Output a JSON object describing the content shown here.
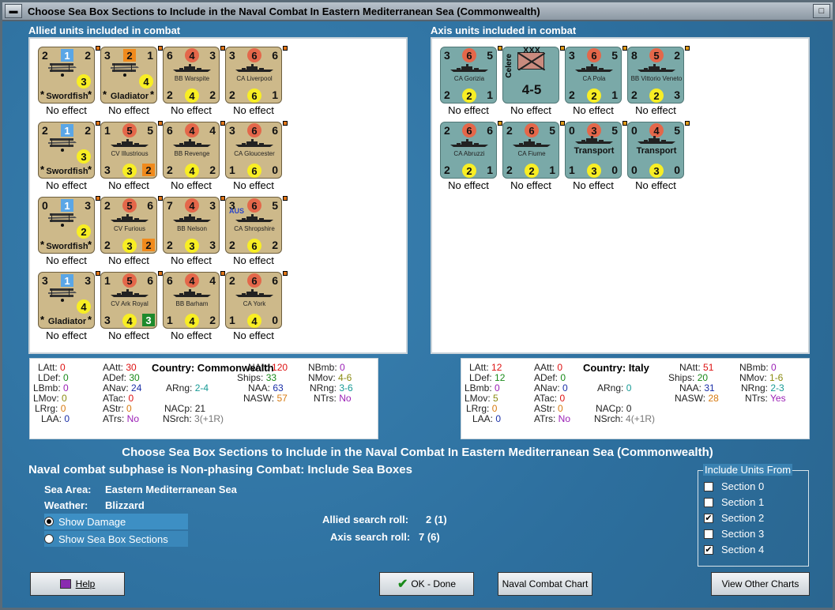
{
  "window": {
    "title": "Choose Sea Box Sections to Include in the Naval Combat In Eastern Mediterranean Sea (Commonwealth)"
  },
  "allied": {
    "header": "Allied units included in combat",
    "units": [
      {
        "l": "2",
        "c": "1",
        "r": "2",
        "bl": "",
        "bc": "3",
        "br": "",
        "name": "Swordfish",
        "kind": "air",
        "effect": "No effect"
      },
      {
        "l": "3",
        "c": "2",
        "r": "1",
        "bl": "",
        "bc": "4",
        "br": "",
        "name": "Gladiator",
        "kind": "air",
        "effect": "No effect"
      },
      {
        "l": "6",
        "c": "4",
        "r": "3",
        "bl": "2",
        "bc": "4",
        "br": "2",
        "name": "BB Warspite",
        "kind": "ship",
        "effect": "No effect"
      },
      {
        "l": "3",
        "c": "6",
        "r": "6",
        "bl": "2",
        "bc": "6",
        "br": "1",
        "name": "CA Liverpool",
        "kind": "ship",
        "effect": "No effect"
      },
      {
        "l": "2",
        "c": "1",
        "r": "2",
        "bl": "",
        "bc": "3",
        "br": "",
        "name": "Swordfish",
        "kind": "air",
        "effect": "No effect"
      },
      {
        "l": "1",
        "c": "5",
        "r": "5",
        "bl": "3",
        "bc": "3",
        "br": "2",
        "name": "CV Illustrious",
        "kind": "ship",
        "effect": "No effect"
      },
      {
        "l": "6",
        "c": "4",
        "r": "4",
        "bl": "2",
        "bc": "4",
        "br": "2",
        "name": "BB Revenge",
        "kind": "ship",
        "effect": "No effect"
      },
      {
        "l": "3",
        "c": "6",
        "r": "6",
        "bl": "1",
        "bc": "6",
        "br": "0",
        "name": "CA Gloucester",
        "kind": "ship",
        "effect": "No effect"
      },
      {
        "l": "0",
        "c": "1",
        "r": "3",
        "bl": "",
        "bc": "2",
        "br": "",
        "name": "Swordfish",
        "kind": "air",
        "effect": "No effect"
      },
      {
        "l": "2",
        "c": "5",
        "r": "6",
        "bl": "2",
        "bc": "3",
        "br": "2",
        "name": "CV Furious",
        "kind": "ship",
        "effect": "No effect"
      },
      {
        "l": "7",
        "c": "4",
        "r": "3",
        "bl": "2",
        "bc": "3",
        "br": "3",
        "name": "BB Nelson",
        "kind": "ship",
        "effect": "No effect"
      },
      {
        "l": "3",
        "c": "6",
        "r": "5",
        "bl": "2",
        "bc": "6",
        "br": "2",
        "name": "CA Shropshire",
        "kind": "ship",
        "tag": "AUS",
        "effect": "No effect"
      },
      {
        "l": "3",
        "c": "1",
        "r": "3",
        "bl": "",
        "bc": "4",
        "br": "",
        "name": "Gladiator",
        "kind": "air",
        "effect": "No effect"
      },
      {
        "l": "1",
        "c": "5",
        "r": "6",
        "bl": "3",
        "bc": "4",
        "br": "3",
        "name": "CV Ark Royal",
        "kind": "ship",
        "effect": "No effect"
      },
      {
        "l": "6",
        "c": "4",
        "r": "4",
        "bl": "1",
        "bc": "4",
        "br": "2",
        "name": "BB Barham",
        "kind": "ship",
        "effect": "No effect"
      },
      {
        "l": "2",
        "c": "6",
        "r": "6",
        "bl": "1",
        "bc": "4",
        "br": "0",
        "name": "CA York",
        "kind": "ship",
        "effect": "No effect"
      }
    ]
  },
  "axis": {
    "header": "Axis units included in combat",
    "units": [
      {
        "l": "3",
        "c": "6",
        "r": "5",
        "bl": "2",
        "bc": "2",
        "br": "1",
        "name": "CA Gorizia",
        "kind": "ship",
        "effect": "No effect"
      },
      {
        "l": "",
        "c": "",
        "r": "",
        "bl": "",
        "bc": "",
        "br": "",
        "name": "Celere",
        "kind": "army",
        "size": "XXX",
        "strength": "4-5",
        "effect": "No effect"
      },
      {
        "l": "3",
        "c": "6",
        "r": "5",
        "bl": "2",
        "bc": "2",
        "br": "1",
        "name": "CA Pola",
        "kind": "ship",
        "effect": "No effect"
      },
      {
        "l": "8",
        "c": "5",
        "r": "2",
        "bl": "2",
        "bc": "2",
        "br": "3",
        "name": "BB Vittorio Veneto",
        "kind": "ship",
        "effect": "No effect"
      },
      {
        "l": "2",
        "c": "6",
        "r": "6",
        "bl": "2",
        "bc": "2",
        "br": "1",
        "name": "CA Abruzzi",
        "kind": "ship",
        "effect": "No effect"
      },
      {
        "l": "2",
        "c": "6",
        "r": "5",
        "bl": "2",
        "bc": "2",
        "br": "1",
        "name": "CA Fiume",
        "kind": "ship",
        "effect": "No effect"
      },
      {
        "l": "0",
        "c": "3",
        "r": "5",
        "bl": "1",
        "bc": "3",
        "br": "0",
        "name": "Transport",
        "kind": "transport",
        "effect": "No effect"
      },
      {
        "l": "0",
        "c": "4",
        "r": "5",
        "bl": "0",
        "bc": "3",
        "br": "0",
        "name": "Transport",
        "kind": "transport",
        "effect": "No effect"
      }
    ]
  },
  "allied_stats": {
    "latt": "0",
    "ldef": "0",
    "lbmb": "0",
    "lmov": "0",
    "lrrg": "0",
    "laa": "0",
    "aatt": "30",
    "adef": "30",
    "anav": "24",
    "atac": "0",
    "astr": "0",
    "atrs": "No",
    "country": "Commonwealth",
    "arng": "2-4",
    "nacp": "21",
    "nsrch": "3(+1R)",
    "natt": "120",
    "ships": "33",
    "naa": "63",
    "nasw": "57",
    "nbmb": "0",
    "nmov": "4-6",
    "nrng": "3-6",
    "ntrs": "No"
  },
  "axis_stats": {
    "latt": "12",
    "ldef": "12",
    "lbmb": "0",
    "lmov": "5",
    "lrrg": "0",
    "laa": "0",
    "aatt": "0",
    "adef": "0",
    "anav": "0",
    "atac": "0",
    "astr": "0",
    "atrs": "No",
    "country": "Italy",
    "arng": "0",
    "nacp": "0",
    "nsrch": "4(+1R)",
    "natt": "51",
    "ships": "20",
    "naa": "31",
    "nasw": "28",
    "nbmb": "0",
    "nmov": "1-6",
    "nrng": "2-3",
    "ntrs": "Yes"
  },
  "labels": {
    "latt": "LAtt:",
    "ldef": "LDef:",
    "lbmb": "LBmb:",
    "lmov": "LMov:",
    "lrrg": "LRrg:",
    "laa": "LAA:",
    "aatt": "AAtt:",
    "adef": "ADef:",
    "anav": "ANav:",
    "atac": "ATac:",
    "astr": "AStr:",
    "atrs": "ATrs:",
    "country": "Country:",
    "arng": "ARng:",
    "nacp": "NACp:",
    "nsrch": "NSrch:",
    "natt": "NAtt:",
    "ships": "Ships:",
    "naa": "NAA:",
    "nasw": "NASW:",
    "nbmb": "NBmb:",
    "nmov": "NMov:",
    "nrng": "NRng:",
    "ntrs": "NTrs:"
  },
  "info": {
    "heading": "Choose Sea Box Sections to Include in the Naval Combat In Eastern Mediterranean Sea (Commonwealth)",
    "subphase": "Naval combat subphase is Non-phasing Combat: Include Sea Boxes",
    "sea_area_label": "Sea Area:",
    "sea_area": "Eastern Mediterranean Sea",
    "weather_label": "Weather:",
    "weather": "Blizzard",
    "show_damage": "Show Damage",
    "show_sections": "Show Sea Box Sections",
    "allied_roll_label": "Allied search roll:",
    "allied_roll": "2 (1)",
    "axis_roll_label": "Axis search roll:",
    "axis_roll": "7 (6)"
  },
  "include": {
    "title": "Include Units From",
    "sections": [
      {
        "label": "Section 0",
        "checked": false
      },
      {
        "label": "Section 1",
        "checked": false
      },
      {
        "label": "Section 2",
        "checked": true
      },
      {
        "label": "Section 3",
        "checked": false
      },
      {
        "label": "Section 4",
        "checked": true
      }
    ]
  },
  "buttons": {
    "help": "Help",
    "ok": "OK - Done",
    "chart": "Naval Combat Chart",
    "other": "View Other Charts"
  }
}
